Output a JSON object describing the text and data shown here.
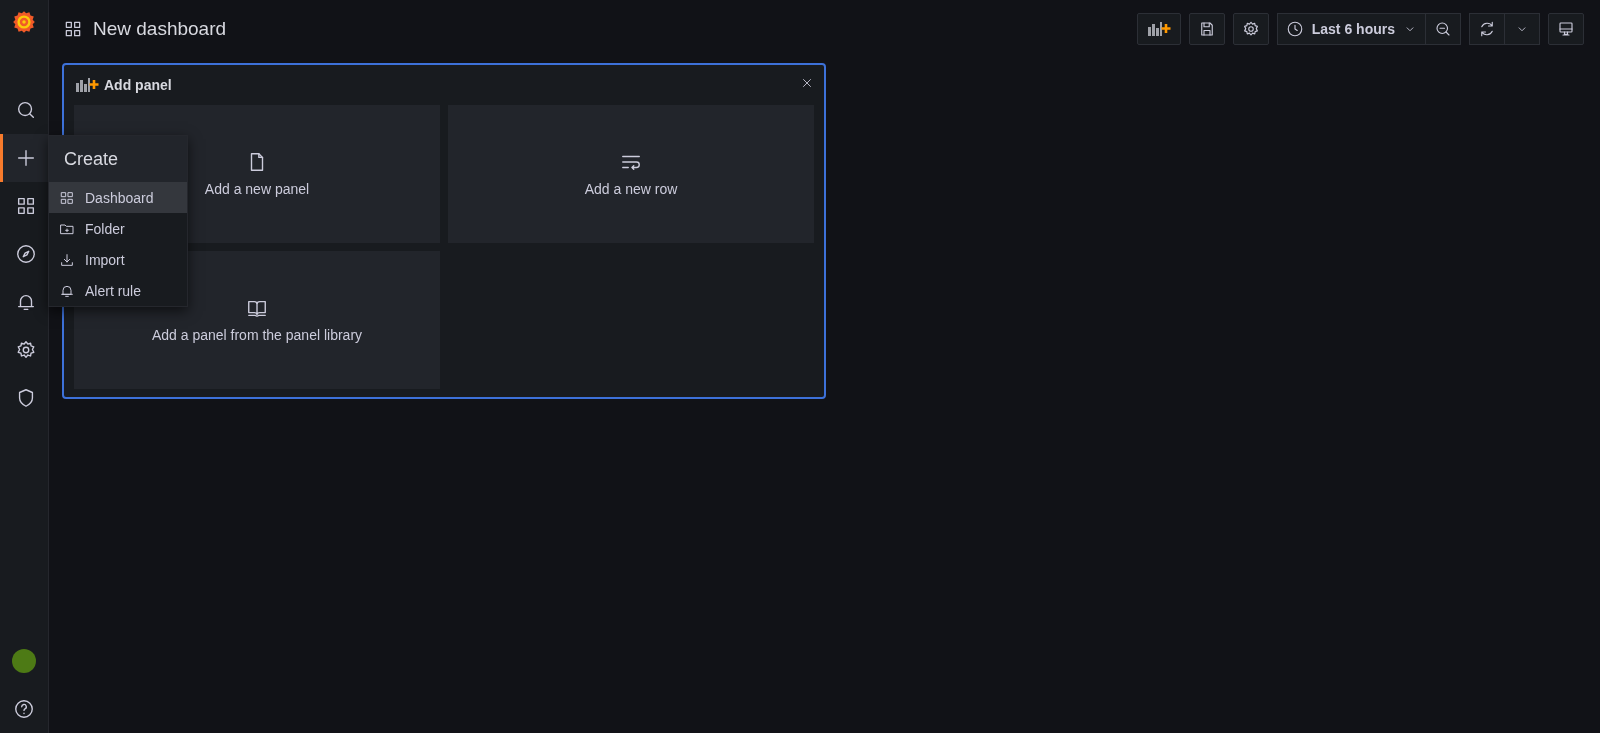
{
  "sidebar": {
    "items": [
      {
        "selected": false
      },
      {
        "selected": true
      },
      {
        "selected": false
      },
      {
        "selected": false
      },
      {
        "selected": false
      },
      {
        "selected": false
      },
      {
        "selected": false
      }
    ]
  },
  "header": {
    "title": "New dashboard"
  },
  "toolbar": {
    "time_range": "Last 6 hours"
  },
  "add_panel": {
    "title": "Add panel",
    "tiles": [
      {
        "label": "Add a new panel"
      },
      {
        "label": "Add a new row"
      },
      {
        "label": "Add a panel from the panel library"
      }
    ]
  },
  "create_menu": {
    "title": "Create",
    "items": [
      {
        "label": "Dashboard",
        "selected": true
      },
      {
        "label": "Folder",
        "selected": false
      },
      {
        "label": "Import",
        "selected": false
      },
      {
        "label": "Alert rule",
        "selected": false
      }
    ]
  }
}
